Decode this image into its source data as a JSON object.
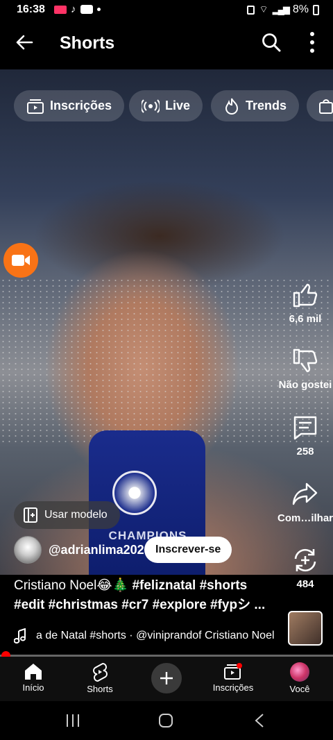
{
  "status": {
    "time": "16:38",
    "battery": "8%"
  },
  "header": {
    "title": "Shorts"
  },
  "chips": [
    {
      "label": "Inscrições"
    },
    {
      "label": "Live"
    },
    {
      "label": "Trends"
    }
  ],
  "video": {
    "mic_text": "CHAMPIONS"
  },
  "rail": {
    "likes": "6,6 mil",
    "dislike": "Não gostei",
    "comments": "258",
    "share": "Com…ilhar",
    "remix": "484"
  },
  "template": {
    "label": "Usar modelo"
  },
  "channel": {
    "name": "@adrianlima202",
    "subscribe": "Inscrever-se"
  },
  "caption": {
    "line1_plain": "Cristiano Noel😂🎄",
    "line1_tags": "#feliznatal #shorts",
    "line2": "#edit #christmas #cr7 #explore #fypシ  ..."
  },
  "music": {
    "text": "a de Natal #shorts · @viniprandof    Cristiano Noel"
  },
  "nav": {
    "home": "Início",
    "shorts": "Shorts",
    "subscriptions": "Inscrições",
    "you": "Você"
  },
  "colors": {
    "accent": "#ff0000",
    "record": "#f97316"
  }
}
